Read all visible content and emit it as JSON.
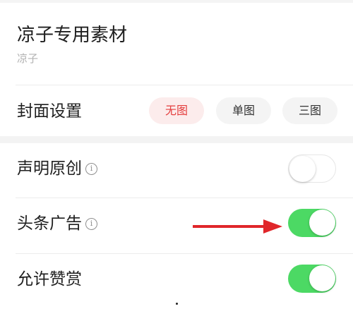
{
  "collection": {
    "title": "凉子专用素材",
    "author": "凉子"
  },
  "cover_settings": {
    "label": "封面设置",
    "options": [
      {
        "label": "无图",
        "selected": true
      },
      {
        "label": "单图",
        "selected": false
      },
      {
        "label": "三图",
        "selected": false
      }
    ]
  },
  "settings": [
    {
      "label": "声明原创",
      "has_info": true,
      "enabled": false
    },
    {
      "label": "头条广告",
      "has_info": true,
      "enabled": true
    },
    {
      "label": "允许赞赏",
      "has_info": false,
      "enabled": true
    }
  ],
  "icons": {
    "info": "info-circle-icon",
    "annotation": "red-arrow-icon"
  },
  "colors": {
    "selected_text": "#e43d3d",
    "selected_bg": "#fcecec",
    "toggle_on": "#4cd964",
    "arrow": "#e0262a"
  }
}
